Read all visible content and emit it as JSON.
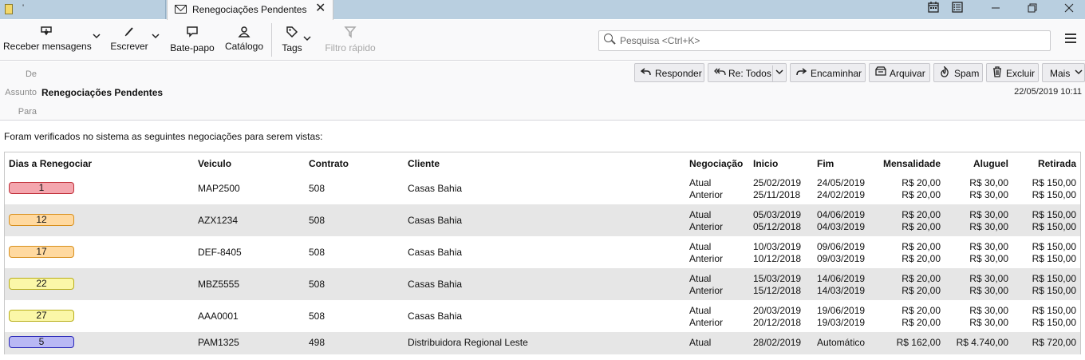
{
  "tabs": {
    "first_label": "'",
    "active_label": "Renegociações Pendentes -",
    "close_glyph": "✕"
  },
  "toolbar": {
    "receber": "Receber mensagens",
    "escrever": "Escrever",
    "batepapo": "Bate-papo",
    "catalogo": "Catálogo",
    "tags": "Tags",
    "filtro": "Filtro rápido",
    "search_placeholder": "Pesquisa <Ctrl+K>"
  },
  "header": {
    "de_label": "De",
    "assunto_label": "Assunto",
    "assunto": "Renegociações Pendentes",
    "para_label": "Para",
    "date": "22/05/2019 10:11",
    "actions": {
      "responder": "Responder",
      "re_todos": "Re: Todos",
      "encaminhar": "Encaminhar",
      "arquivar": "Arquivar",
      "spam": "Spam",
      "excluir": "Excluir",
      "mais": "Mais"
    }
  },
  "body": {
    "intro": "Foram verificados no sistema as seguintes negociações para serem vistas:"
  },
  "table": {
    "columns": {
      "dias": "Dias a Renegociar",
      "veiculo": "Veiculo",
      "contrato": "Contrato",
      "cliente": "Cliente",
      "negociacao": "Negociação",
      "inicio": "Inicio",
      "fim": "Fim",
      "mensalidade": "Mensalidade",
      "aluguel": "Aluguel",
      "retirada": "Retirada"
    },
    "rows": [
      {
        "dias": "1",
        "veiculo": "MAP2500",
        "contrato": "508",
        "cliente": "Casas Bahia",
        "neg1": "Atual",
        "neg2": "Anterior",
        "ini1": "25/02/2019",
        "ini2": "25/11/2018",
        "fim1": "24/05/2019",
        "fim2": "24/02/2019",
        "men1": "R$ 20,00",
        "men2": "R$ 20,00",
        "alu1": "R$ 30,00",
        "alu2": "R$ 30,00",
        "ret1": "R$ 150,00",
        "ret2": "R$ 150,00"
      },
      {
        "dias": "12",
        "veiculo": "AZX1234",
        "contrato": "508",
        "cliente": "Casas Bahia",
        "neg1": "Atual",
        "neg2": "Anterior",
        "ini1": "05/03/2019",
        "ini2": "05/12/2018",
        "fim1": "04/06/2019",
        "fim2": "04/03/2019",
        "men1": "R$ 20,00",
        "men2": "R$ 20,00",
        "alu1": "R$ 30,00",
        "alu2": "R$ 30,00",
        "ret1": "R$ 150,00",
        "ret2": "R$ 150,00"
      },
      {
        "dias": "17",
        "veiculo": "DEF-8405",
        "contrato": "508",
        "cliente": "Casas Bahia",
        "neg1": "Atual",
        "neg2": "Anterior",
        "ini1": "10/03/2019",
        "ini2": "10/12/2018",
        "fim1": "09/06/2019",
        "fim2": "09/03/2019",
        "men1": "R$ 20,00",
        "men2": "R$ 20,00",
        "alu1": "R$ 30,00",
        "alu2": "R$ 30,00",
        "ret1": "R$ 150,00",
        "ret2": "R$ 150,00"
      },
      {
        "dias": "22",
        "veiculo": "MBZ5555",
        "contrato": "508",
        "cliente": "Casas Bahia",
        "neg1": "Atual",
        "neg2": "Anterior",
        "ini1": "15/03/2019",
        "ini2": "15/12/2018",
        "fim1": "14/06/2019",
        "fim2": "14/03/2019",
        "men1": "R$ 20,00",
        "men2": "R$ 20,00",
        "alu1": "R$ 30,00",
        "alu2": "R$ 30,00",
        "ret1": "R$ 150,00",
        "ret2": "R$ 150,00"
      },
      {
        "dias": "27",
        "veiculo": "AAA0001",
        "contrato": "508",
        "cliente": "Casas Bahia",
        "neg1": "Atual",
        "neg2": "Anterior",
        "ini1": "20/03/2019",
        "ini2": "20/12/2018",
        "fim1": "19/06/2019",
        "fim2": "19/03/2019",
        "men1": "R$ 20,00",
        "men2": "R$ 20,00",
        "alu1": "R$ 30,00",
        "alu2": "R$ 30,00",
        "ret1": "R$ 150,00",
        "ret2": "R$ 150,00"
      },
      {
        "dias": "5",
        "veiculo": "PAM1325",
        "contrato": "498",
        "cliente": "Distribuidora Regional Leste",
        "neg1": "Atual",
        "ini1": "28/02/2019",
        "fim1": "Automático",
        "men1": "R$ 162,00",
        "alu1": "R$ 4.740,00",
        "ret1": "R$ 720,00"
      }
    ],
    "badge_colors": [
      {
        "bg": "#f4a6ae",
        "border": "#c0303a"
      },
      {
        "bg": "#ffd9a0",
        "border": "#d8901e"
      },
      {
        "bg": "#ffd9a0",
        "border": "#d8901e"
      },
      {
        "bg": "#fbf7a8",
        "border": "#b8ae1a"
      },
      {
        "bg": "#fbf7a8",
        "border": "#b8ae1a"
      },
      {
        "bg": "#b9b8f4",
        "border": "#2a28b8"
      }
    ]
  }
}
